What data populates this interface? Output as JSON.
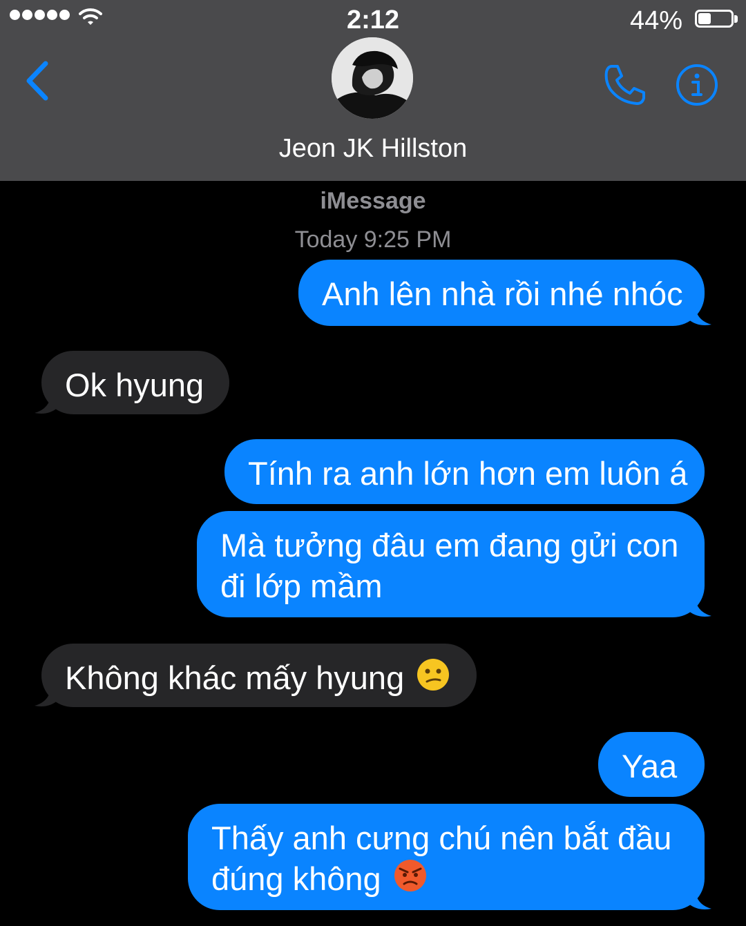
{
  "status_bar": {
    "time": "2:12",
    "battery_percent_label": "44%",
    "battery_level": 0.44,
    "signal_bars": 5
  },
  "header": {
    "contact_name": "Jeon JK Hillston",
    "back_icon": "chevron-left-icon",
    "call_icon": "phone-icon",
    "info_icon": "info-icon",
    "accent_color": "#0a84ff"
  },
  "conversation": {
    "service": "iMessage",
    "timestamp": "Today 9:25 PM",
    "messages": [
      {
        "direction": "sent",
        "text": "Anh lên nhà rồi nhé nhóc"
      },
      {
        "direction": "received",
        "text": "Ok hyung"
      },
      {
        "direction": "sent",
        "text": "Tính ra anh lớn hơn em luôn á"
      },
      {
        "direction": "sent",
        "text": "Mà tưởng đâu em đang gửi con đi lớp mầm"
      },
      {
        "direction": "received",
        "text": "Không khác mấy hyung",
        "emoji": "confused-face"
      },
      {
        "direction": "sent",
        "text": "Yaa"
      },
      {
        "direction": "sent",
        "text": "Thấy anh cưng chú nên bắt đầu đúng không",
        "emoji": "angry-face"
      }
    ]
  },
  "colors": {
    "sent_bubble": "#0a84ff",
    "received_bubble": "#262628",
    "header_bg": "#4a4a4c",
    "background": "#000000"
  }
}
